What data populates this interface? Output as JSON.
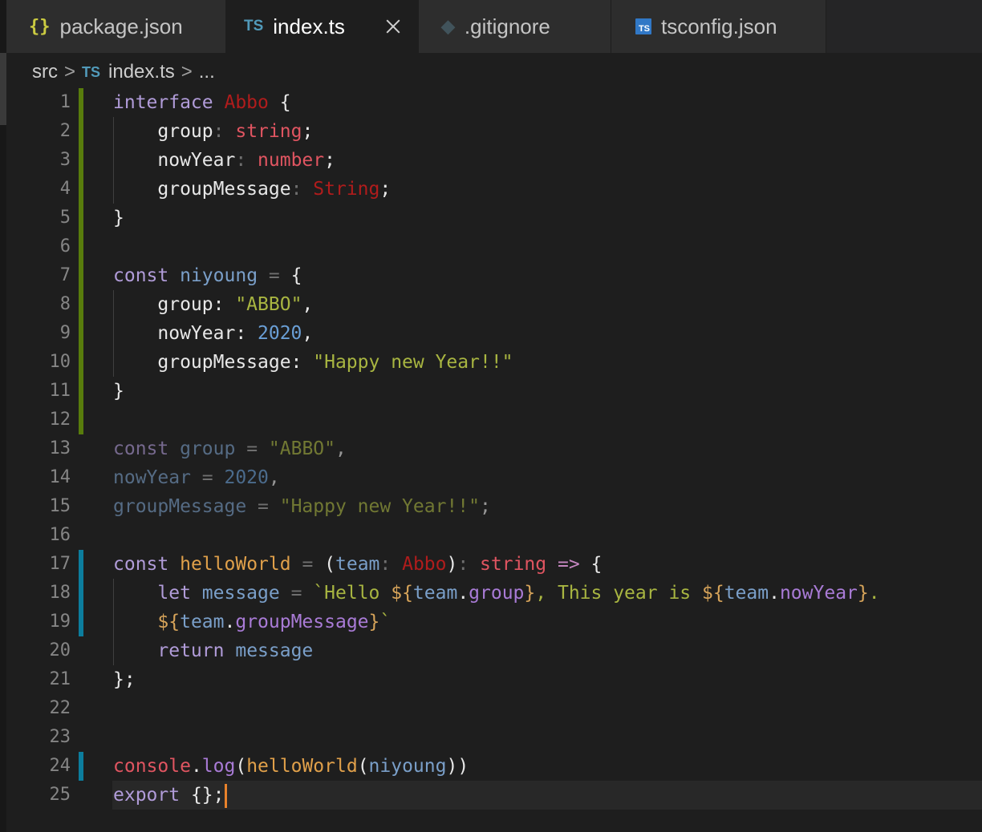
{
  "tabs": [
    {
      "label": "package.json",
      "icon": "json-braces-icon",
      "glyph": "{}",
      "active": false
    },
    {
      "label": "index.ts",
      "icon": "typescript-icon",
      "glyph": "TS",
      "active": true
    },
    {
      "label": ".gitignore",
      "icon": "git-icon",
      "glyph": "◆",
      "active": false
    },
    {
      "label": "tsconfig.json",
      "icon": "tsconfig-icon",
      "glyph": "TS",
      "active": false
    }
  ],
  "breadcrumb": {
    "folder": "src",
    "separator": ">",
    "file_icon": "TS",
    "file": "index.ts",
    "trail": "..."
  },
  "editor": {
    "line_numbers": [
      "1",
      "2",
      "3",
      "4",
      "5",
      "6",
      "7",
      "8",
      "9",
      "10",
      "11",
      "12",
      "13",
      "14",
      "15",
      "16",
      "17",
      "18",
      "19",
      "20",
      "21",
      "22",
      "23",
      "24",
      "25"
    ],
    "lines": [
      [
        [
          "interface",
          "kw"
        ],
        [
          " ",
          ""
        ],
        [
          "Abbo",
          "typerr"
        ],
        [
          " {",
          "pl"
        ]
      ],
      [
        [
          "    ",
          ""
        ],
        [
          "group",
          "pl"
        ],
        [
          ": ",
          "op"
        ],
        [
          "string",
          "typ"
        ],
        [
          ";",
          "pl"
        ]
      ],
      [
        [
          "    ",
          ""
        ],
        [
          "nowYear",
          "pl"
        ],
        [
          ": ",
          "op"
        ],
        [
          "number",
          "typ"
        ],
        [
          ";",
          "pl"
        ]
      ],
      [
        [
          "    ",
          ""
        ],
        [
          "groupMessage",
          "pl"
        ],
        [
          ": ",
          "op"
        ],
        [
          "String",
          "typerr"
        ],
        [
          ";",
          "pl"
        ]
      ],
      [
        [
          "}",
          "pl"
        ]
      ],
      [],
      [
        [
          "const",
          "kw"
        ],
        [
          " ",
          ""
        ],
        [
          "niyoung",
          "var"
        ],
        [
          " = ",
          "op"
        ],
        [
          "{",
          "pl"
        ]
      ],
      [
        [
          "    ",
          ""
        ],
        [
          "group: ",
          "pl"
        ],
        [
          "\"ABBO\"",
          "str"
        ],
        [
          ",",
          "pl"
        ]
      ],
      [
        [
          "    ",
          ""
        ],
        [
          "nowYear: ",
          "pl"
        ],
        [
          "2020",
          "num"
        ],
        [
          ",",
          "pl"
        ]
      ],
      [
        [
          "    ",
          ""
        ],
        [
          "groupMessage: ",
          "pl"
        ],
        [
          "\"Happy new Year!!\"",
          "str"
        ]
      ],
      [
        [
          "}",
          "pl"
        ]
      ],
      [],
      [
        [
          "const",
          "kw dim"
        ],
        [
          " ",
          ""
        ],
        [
          "group",
          "var dim"
        ],
        [
          " = ",
          "op"
        ],
        [
          "\"ABBO\"",
          "str dim"
        ],
        [
          ",",
          "pl dim"
        ]
      ],
      [
        [
          "nowYear",
          "var dim"
        ],
        [
          " = ",
          "op"
        ],
        [
          "2020",
          "num dim"
        ],
        [
          ",",
          "pl dim"
        ]
      ],
      [
        [
          "groupMessage",
          "var dim"
        ],
        [
          " = ",
          "op"
        ],
        [
          "\"Happy new Year!!\"",
          "str dim"
        ],
        [
          ";",
          "pl dim"
        ]
      ],
      [],
      [
        [
          "const",
          "kw"
        ],
        [
          " ",
          ""
        ],
        [
          "helloWorld",
          "fn"
        ],
        [
          " = ",
          "op"
        ],
        [
          "(",
          "pl"
        ],
        [
          "team",
          "var"
        ],
        [
          ": ",
          "op"
        ],
        [
          "Abbo",
          "typerr"
        ],
        [
          ")",
          "pl"
        ],
        [
          ": ",
          "op"
        ],
        [
          "string",
          "typ"
        ],
        [
          " => ",
          "kwp"
        ],
        [
          "{",
          "pl"
        ]
      ],
      [
        [
          "    ",
          ""
        ],
        [
          "let",
          "kw"
        ],
        [
          " ",
          ""
        ],
        [
          "message",
          "var"
        ],
        [
          " = ",
          "op"
        ],
        [
          "`Hello ",
          "str"
        ],
        [
          "${",
          "tpl"
        ],
        [
          "team",
          "var"
        ],
        [
          ".",
          "pl"
        ],
        [
          "group",
          "prop"
        ],
        [
          "}",
          "tpl"
        ],
        [
          ", This year is ",
          "str"
        ],
        [
          "${",
          "tpl"
        ],
        [
          "team",
          "var"
        ],
        [
          ".",
          "pl"
        ],
        [
          "nowYear",
          "prop"
        ],
        [
          "}",
          "tpl"
        ],
        [
          ".",
          "str"
        ]
      ],
      [
        [
          "    ",
          ""
        ],
        [
          "${",
          "tpl"
        ],
        [
          "team",
          "var"
        ],
        [
          ".",
          "pl"
        ],
        [
          "groupMessage",
          "prop"
        ],
        [
          "}",
          "tpl"
        ],
        [
          "`",
          "str"
        ]
      ],
      [
        [
          "    ",
          ""
        ],
        [
          "return",
          "kw"
        ],
        [
          " ",
          ""
        ],
        [
          "message",
          "var"
        ]
      ],
      [
        [
          "};",
          "pl"
        ]
      ],
      [],
      [],
      [
        [
          "console",
          "log"
        ],
        [
          ".",
          "pl"
        ],
        [
          "log",
          "prop"
        ],
        [
          "(",
          "pl"
        ],
        [
          "helloWorld",
          "fn"
        ],
        [
          "(",
          "pl"
        ],
        [
          "niyoung",
          "var"
        ],
        [
          "))",
          "pl"
        ]
      ],
      [
        [
          "export",
          "kw"
        ],
        [
          " {};",
          "pl"
        ]
      ]
    ],
    "gutter_markers": [
      "add",
      "add",
      "add",
      "add",
      "add",
      "add",
      "add",
      "add",
      "add",
      "add",
      "add",
      "add",
      "",
      "",
      "",
      "",
      "mod",
      "mod",
      "mod",
      "",
      "",
      "",
      "",
      "mod",
      ""
    ],
    "current_line": 25
  }
}
